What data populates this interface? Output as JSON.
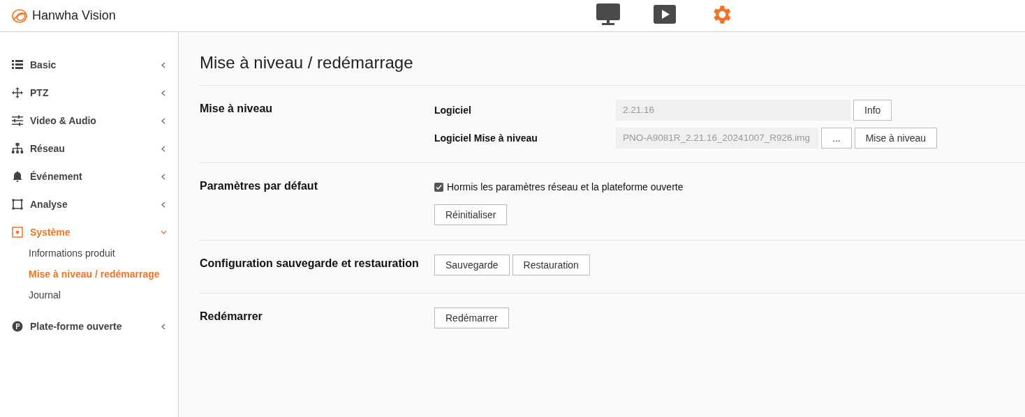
{
  "brand": "Hanwha Vision",
  "top_nav": [
    {
      "kind": "monitor",
      "selected": false
    },
    {
      "kind": "play",
      "selected": false
    },
    {
      "kind": "settings",
      "selected": true
    }
  ],
  "sidebar": {
    "items": [
      {
        "kind": "list",
        "label": "Basic",
        "selected": false,
        "expanded": false
      },
      {
        "kind": "move",
        "label": "PTZ",
        "selected": false,
        "expanded": false
      },
      {
        "kind": "sliders",
        "label": "Video & Audio",
        "selected": false,
        "expanded": false
      },
      {
        "kind": "network",
        "label": "Réseau",
        "selected": false,
        "expanded": false
      },
      {
        "kind": "bell",
        "label": "Événement",
        "selected": false,
        "expanded": false
      },
      {
        "kind": "frame",
        "label": "Analyse",
        "selected": false,
        "expanded": false
      },
      {
        "kind": "system",
        "label": "Système",
        "selected": true,
        "expanded": true,
        "children": [
          {
            "label": "Informations produit",
            "selected": false
          },
          {
            "label": "Mise à niveau / redémarrage",
            "selected": true
          },
          {
            "label": "Journal",
            "selected": false
          }
        ]
      },
      {
        "kind": "platform",
        "label": "Plate-forme ouverte",
        "selected": false,
        "expanded": false
      }
    ]
  },
  "page_title": "Mise à niveau / redémarrage",
  "sections": [
    {
      "kind": "upgrade",
      "title": "Mise à niveau",
      "rows": [
        {
          "label": "Logiciel",
          "value": "2.21.16",
          "buttons": [
            "Info"
          ]
        },
        {
          "label": "Logiciel Mise à niveau",
          "value": "PNO-A9081R_2.21.16_20241007_R926.img",
          "buttons": [
            "...",
            "Mise à niveau"
          ]
        }
      ]
    },
    {
      "kind": "reset",
      "title": "Paramètres par défaut",
      "checkbox": {
        "label": "Hormis les paramètres réseau et la plateforme ouverte",
        "checked": true
      },
      "buttons": [
        "Réinitialiser"
      ]
    },
    {
      "kind": "buttons",
      "title": "Configuration sauvegarde et restauration",
      "buttons": [
        "Sauvegarde",
        "Restauration"
      ]
    },
    {
      "kind": "buttons",
      "title": "Redémarrer",
      "buttons": [
        "Redémarrer"
      ]
    }
  ]
}
